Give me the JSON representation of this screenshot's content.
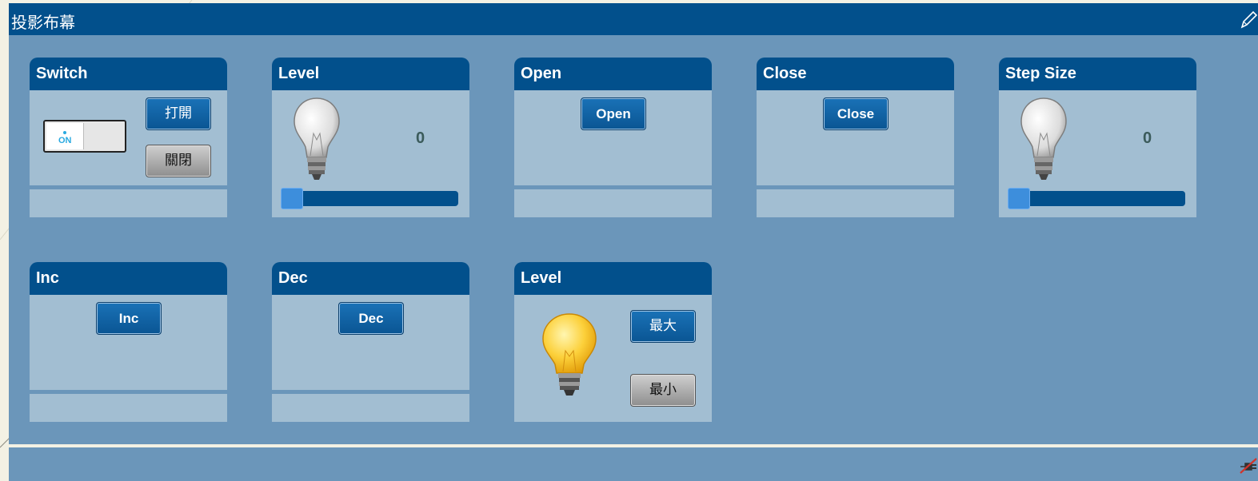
{
  "panel": {
    "title": "投影布幕"
  },
  "widgets": {
    "switch": {
      "title": "Switch",
      "toggle_label": "ON",
      "on_button": "打開",
      "off_button": "關閉"
    },
    "level1": {
      "title": "Level",
      "value": "0",
      "slider_fraction": 0
    },
    "open": {
      "title": "Open",
      "button": "Open"
    },
    "close": {
      "title": "Close",
      "button": "Close"
    },
    "step": {
      "title": "Step Size",
      "value": "0",
      "slider_fraction": 0
    },
    "inc": {
      "title": "Inc",
      "button": "Inc"
    },
    "dec": {
      "title": "Dec",
      "button": "Dec"
    },
    "level2": {
      "title": "Level",
      "max_button": "最大",
      "min_button": "最小"
    }
  },
  "icons": {
    "edit": "pencil-icon",
    "bulb_off": "light-bulb-off-icon",
    "bulb_on": "light-bulb-on-icon",
    "disconnected": "disconnected-plug-icon"
  },
  "colors": {
    "header": "#02508c",
    "panel": "#6b96ba",
    "widget_body": "#a2bed2",
    "slider_handle": "#3d8edc"
  }
}
